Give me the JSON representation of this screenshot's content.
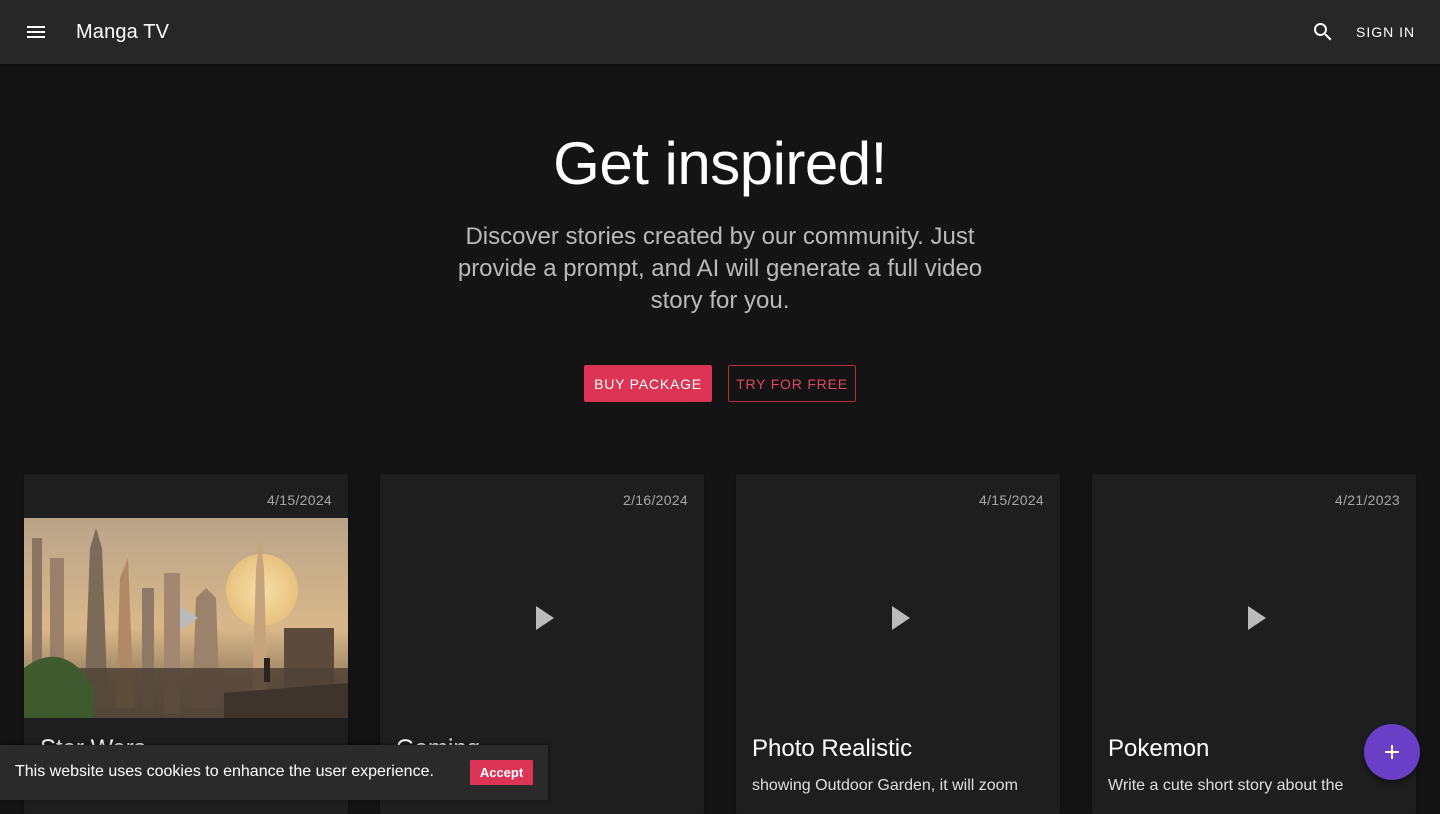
{
  "appbar": {
    "menu_icon": "menu-icon",
    "title": "Manga TV",
    "search_icon": "search-icon",
    "signin_label": "SIGN IN"
  },
  "hero": {
    "title": "Get inspired!",
    "subtitle": "Discover stories created by our community. Just provide a prompt, and AI will generate a full video story for you.",
    "buy_label": "BUY PACKAGE",
    "try_label": "TRY FOR FREE"
  },
  "cards": [
    {
      "date": "4/15/2024",
      "title": "Star Wars",
      "description": "",
      "has_thumbnail": true,
      "play_icon": "play-icon"
    },
    {
      "date": "2/16/2024",
      "title": "Gaming",
      "description": "",
      "has_thumbnail": false,
      "play_icon": "play-icon"
    },
    {
      "date": "4/15/2024",
      "title": "Photo Realistic",
      "description": "showing Outdoor Garden, it will zoom",
      "has_thumbnail": false,
      "play_icon": "play-icon"
    },
    {
      "date": "4/21/2023",
      "title": "Pokemon",
      "description": "Write a cute short story about the",
      "has_thumbnail": false,
      "play_icon": "play-icon"
    }
  ],
  "cookie": {
    "text": "This website uses cookies to enhance the user experience.",
    "accept_label": "Accept"
  },
  "fab": {
    "icon": "plus-icon"
  },
  "colors": {
    "accent": "#dc3455",
    "fab": "#6a3fc8",
    "appbar": "#272727",
    "background": "#141414",
    "card": "#1e1e1e"
  }
}
